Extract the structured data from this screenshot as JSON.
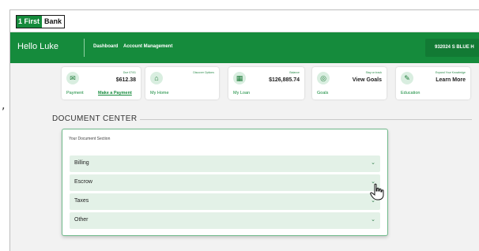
{
  "bank": {
    "logo_part1": "1 First",
    "logo_part2": "Bank"
  },
  "header": {
    "greeting": "Hello Luke",
    "nav": [
      "Dashboard",
      "Account Management"
    ],
    "account": "932024 S BLUE H"
  },
  "cards": [
    {
      "icon": "payment-icon",
      "small": "Due 07/01",
      "value": "$612.38",
      "label": "Payment",
      "link": "Make a Payment"
    },
    {
      "icon": "home-icon",
      "small": "Discover Options",
      "value": "",
      "label": "My Home",
      "link": ""
    },
    {
      "icon": "loan-icon",
      "small": "Balance",
      "value": "$126,885.74",
      "label": "My Loan",
      "link": ""
    },
    {
      "icon": "goal-icon",
      "small": "Stay on track",
      "value": "View Goals",
      "label": "Goals",
      "link": ""
    },
    {
      "icon": "education-icon",
      "small": "Expand Your Knowledge",
      "value": "Learn More",
      "label": "Education",
      "link": ""
    }
  ],
  "document_center": {
    "title": "DOCUMENT CENTER",
    "section_label": "Your Document Section",
    "rows": [
      "Billing",
      "Escrow",
      "Taxes",
      "Other"
    ]
  },
  "colors": {
    "brand_green": "#158b3c",
    "row_bg": "#e3f1e7"
  }
}
